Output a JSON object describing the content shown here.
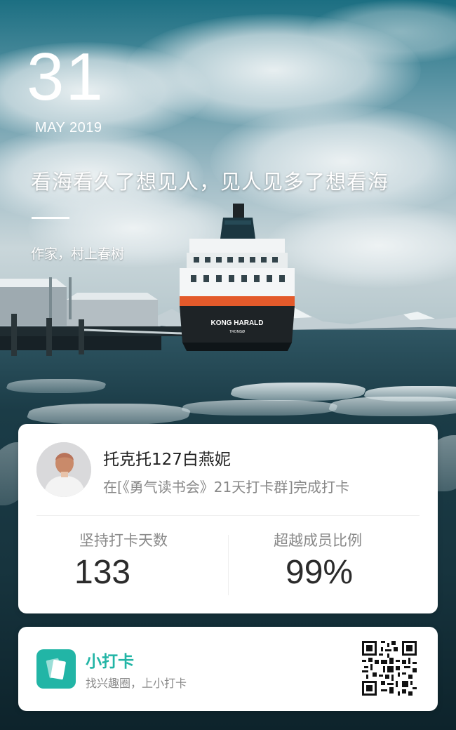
{
  "header": {
    "day": "31",
    "month_year": "MAY 2019",
    "quote": "看海看久了想见人，见人见多了想看海",
    "author": "作家，村上春树"
  },
  "photo": {
    "ship_name": "KONG HARALD",
    "ship_port": "TROMSØ"
  },
  "user_card": {
    "username": "托克托127白燕妮",
    "checkin_text": "在[《勇气读书会》21天打卡群]完成打卡",
    "stats": [
      {
        "label": "坚持打卡天数",
        "value": "133"
      },
      {
        "label": "超越成员比例",
        "value": "99%"
      }
    ]
  },
  "app_card": {
    "name": "小打卡",
    "slogan": "找兴趣圈，上小打卡",
    "qr_icon": "qr-code-icon"
  },
  "colors": {
    "accent": "#22b5a6",
    "text_dark": "#222222",
    "text_muted": "#888888"
  }
}
